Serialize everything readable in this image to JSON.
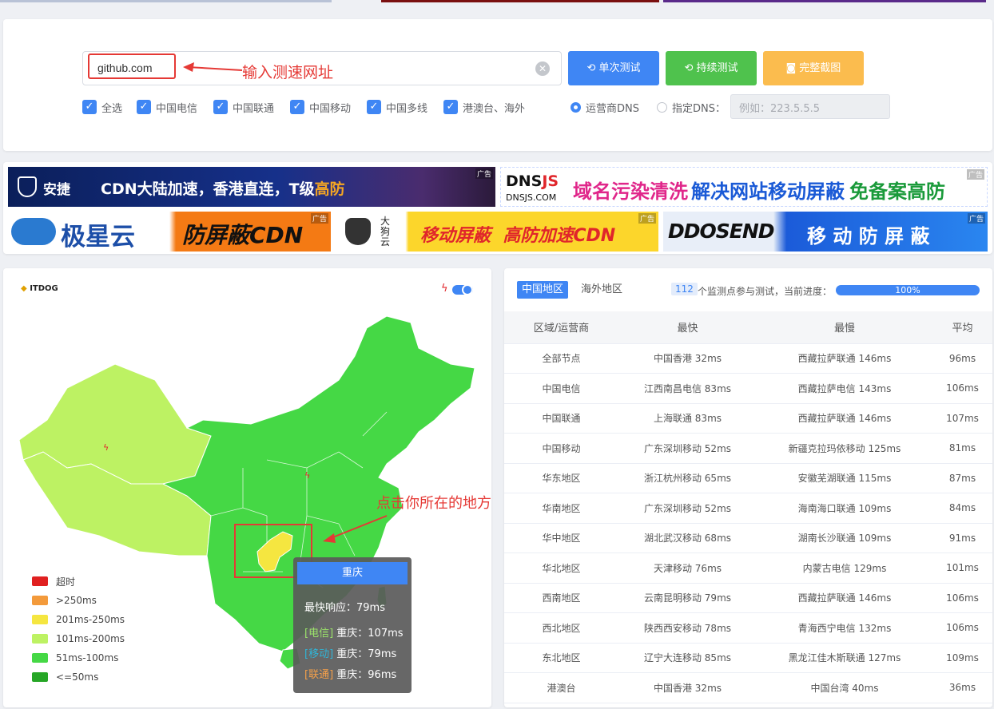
{
  "search": {
    "url_value": "github.com",
    "annotation": "输入测速网址",
    "buttons": {
      "once": "单次测试",
      "continuous": "持续测试",
      "screenshot": "完整截图"
    },
    "isp_checks": [
      "全选",
      "中国电信",
      "中国联通",
      "中国移动",
      "中国多线",
      "港澳台、海外"
    ],
    "dns_options": {
      "isp": "运营商DNS",
      "custom": "指定DNS："
    },
    "dns_placeholder": "例如：223.5.5.5"
  },
  "ads": {
    "tag": "广告",
    "anjie": {
      "brand": "安捷",
      "slogan_a": "CDN大陆加速，香港直连，T级",
      "slogan_b": "高防"
    },
    "dnsjs": {
      "brand_a": "DNS",
      "brand_b": "JS",
      "domain": "DNSJS.COM",
      "slogan_a": "域名污染清洗",
      "slogan_b": "解决网站移动屏蔽",
      "slogan_c": "免备案高防CDN"
    },
    "jixing": {
      "brand": "极星云",
      "slogan": "防屏蔽CDN"
    },
    "dagou": {
      "brand": "大狗云",
      "slogan": "移动屏蔽  高防加速CDN"
    },
    "ddosend": {
      "brand": "DDOSEND",
      "slogan": "移 动 防 屏 蔽"
    }
  },
  "map": {
    "logo": "ITDOG",
    "annotation": "点击你所在的地方",
    "legend": [
      {
        "label": "超时",
        "color": "#e02020"
      },
      {
        "label": ">250ms",
        "color": "#f39a3b"
      },
      {
        "label": "201ms-250ms",
        "color": "#f5e640"
      },
      {
        "label": "101ms-200ms",
        "color": "#bdf263"
      },
      {
        "label": "51ms-100ms",
        "color": "#45d845"
      },
      {
        "label": "<=50ms",
        "color": "#26a626"
      }
    ],
    "tooltip": {
      "title": "重庆",
      "fastest": "最快响应：79ms",
      "lines": [
        {
          "tag": "[电信]",
          "text": " 重庆：107ms",
          "color": "#9be36a"
        },
        {
          "tag": "[移动]",
          "text": " 重庆：79ms",
          "color": "#31b4d6"
        },
        {
          "tag": "[联通]",
          "text": " 重庆：96ms",
          "color": "#f5a04a"
        }
      ]
    }
  },
  "results": {
    "tabs": [
      "中国地区",
      "海外地区"
    ],
    "count": "112",
    "count_text": "个监测点参与测试，当前进度：",
    "progress": "100%",
    "columns": [
      "区域/运营商",
      "最快",
      "最慢",
      "平均"
    ],
    "rows": [
      [
        "全部节点",
        "中国香港 32ms",
        "西藏拉萨联通 146ms",
        "96ms"
      ],
      [
        "中国电信",
        "江西南昌电信 83ms",
        "西藏拉萨电信 143ms",
        "106ms"
      ],
      [
        "中国联通",
        "上海联通 83ms",
        "西藏拉萨联通 146ms",
        "107ms"
      ],
      [
        "中国移动",
        "广东深圳移动 52ms",
        "新疆克拉玛依移动 125ms",
        "81ms"
      ],
      [
        "华东地区",
        "浙江杭州移动 65ms",
        "安徽芜湖联通 115ms",
        "87ms"
      ],
      [
        "华南地区",
        "广东深圳移动 52ms",
        "海南海口联通 109ms",
        "84ms"
      ],
      [
        "华中地区",
        "湖北武汉移动 68ms",
        "湖南长沙联通 109ms",
        "91ms"
      ],
      [
        "华北地区",
        "天津移动 76ms",
        "内蒙古电信 129ms",
        "101ms"
      ],
      [
        "西南地区",
        "云南昆明移动 79ms",
        "西藏拉萨联通 146ms",
        "106ms"
      ],
      [
        "西北地区",
        "陕西西安移动 78ms",
        "青海西宁电信 132ms",
        "106ms"
      ],
      [
        "东北地区",
        "辽宁大连移动 85ms",
        "黑龙江佳木斯联通 127ms",
        "109ms"
      ],
      [
        "港澳台",
        "中国香港 32ms",
        "中国台湾 40ms",
        "36ms"
      ]
    ]
  }
}
